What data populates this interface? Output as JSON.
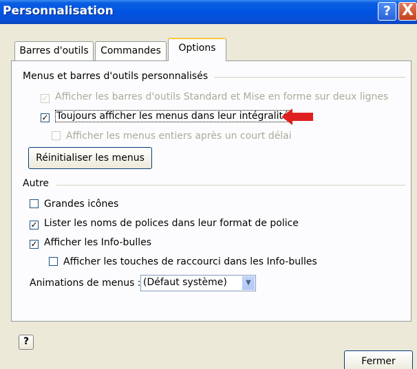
{
  "window": {
    "title": "Personnalisation",
    "help_button": "?",
    "close_button": "X"
  },
  "tabs": [
    {
      "label": "Barres d'outils",
      "active": false
    },
    {
      "label": "Commandes",
      "active": false
    },
    {
      "label": "Options",
      "active": true
    }
  ],
  "group_menus": {
    "title": "Menus et barres d'outils personnalisés",
    "options": [
      {
        "label": "Afficher les barres d'outils Standard et Mise en forme sur deux lignes",
        "checked": true,
        "enabled": false
      },
      {
        "label": "Toujours afficher les menus dans leur intégralité",
        "checked": true,
        "enabled": true,
        "focused": true
      },
      {
        "label": "Afficher les menus entiers après un court délai",
        "checked": false,
        "enabled": false
      }
    ],
    "reset_button": "Réinitialiser les menus"
  },
  "group_other": {
    "title": "Autre",
    "options": [
      {
        "label": "Grandes icônes",
        "checked": false
      },
      {
        "label": "Lister les noms de polices dans leur format de police",
        "checked": true
      },
      {
        "label": "Afficher les Info-bulles",
        "checked": true
      },
      {
        "label": "Afficher les touches de raccourci dans les Info-bulles",
        "checked": false
      }
    ],
    "animations_label": "Animations de menus :",
    "animations_value": "(Défaut système)"
  },
  "footer": {
    "help_icon": "?",
    "close_button": "Fermer"
  },
  "colors": {
    "annotation_arrow": "#e02020",
    "titlebar": "#0054e3",
    "dialog_bg": "#ece9d8"
  },
  "icons": {
    "help": "question-mark-icon",
    "close": "close-x-icon",
    "dropdown": "triangle-down-icon",
    "annotation": "red-arrow-icon"
  }
}
